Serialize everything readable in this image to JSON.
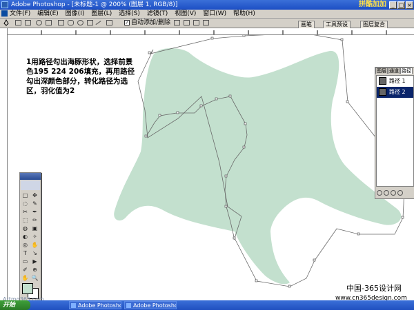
{
  "window": {
    "title": "Adobe Photoshop - [未标题-1 @ 200% (图层 1, RGB/8)]",
    "brand": "拼酷加加",
    "buttons": [
      "_",
      "□",
      "×"
    ]
  },
  "menu": [
    "文件(F)",
    "编辑(E)",
    "图像(I)",
    "图层(L)",
    "选择(S)",
    "滤镜(T)",
    "视图(V)",
    "窗口(W)",
    "帮助(H)"
  ],
  "options": {
    "autoadd_label": "自动添加/删除",
    "autoadd_checked": "✓"
  },
  "palette_tabs": [
    "画笔",
    "工具预设",
    "图层复合"
  ],
  "note_text": "1用路径勾出海豚形状，选择前景色195 224 206填充，再用路径勾出深颜色部分，转化路径为选区，羽化值为2",
  "colors": {
    "dolphin_fill": "#c3e0ce",
    "path_stroke": "#6a6a6a",
    "accent": "#0a246a"
  },
  "paths_panel": {
    "tabs": [
      "图层",
      "通道",
      "路径"
    ],
    "active_tab": "路径",
    "items": [
      {
        "label": "路径 1"
      },
      {
        "label": "路径 2"
      }
    ],
    "selected": "路径 2"
  },
  "toolbox": {
    "tools": [
      "□",
      "✥",
      "◌",
      "✎",
      "✂",
      "✒",
      "⬚",
      "✏",
      "◍",
      "▣",
      "◐",
      "✧",
      "◎",
      "✋",
      "T",
      "↘",
      "▭",
      "▶",
      "✐",
      "⊕",
      "✋",
      "🔍"
    ]
  },
  "taskbar": {
    "start": "开始",
    "tasks": [
      "Adobe Photoshop ...",
      "Adobe Photoshop ..."
    ]
  },
  "watermark": {
    "site": "中国-365设计网",
    "url": "www.cn365design.com",
    "left": "Artmg365.com"
  }
}
